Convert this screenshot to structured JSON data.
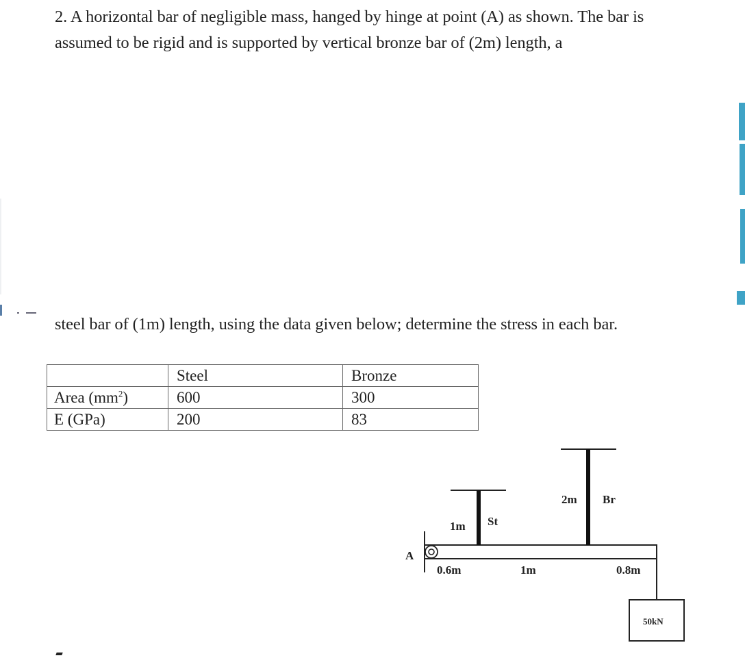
{
  "problem": {
    "paragraph_1": "2. A horizontal bar of negligible mass, hanged by hinge at point (A) as shown. The bar is assumed to be rigid and is supported by vertical bronze bar of (2m) length, a",
    "paragraph_2": "steel bar of (1m) length, using the data given below; determine the stress in each bar."
  },
  "table": {
    "headers": [
      "",
      "Steel",
      "Bronze"
    ],
    "rows": [
      {
        "label": "Area (mm",
        "label_sup": "2",
        "label_suffix": ")",
        "steel": "600",
        "bronze": "300"
      },
      {
        "label": "E (GPa)",
        "label_sup": "",
        "label_suffix": "",
        "steel": "200",
        "bronze": "83"
      }
    ]
  },
  "diagram": {
    "hinge_label": "A",
    "steel_length_label": "1m",
    "steel_name_label": "St",
    "bronze_length_label": "2m",
    "bronze_name_label": "Br",
    "segment_labels": [
      "0.6m",
      "1m",
      "0.8m"
    ],
    "load_label": "50kN",
    "segments_m": [
      0.6,
      1.0,
      0.8
    ],
    "steel_length_m": 1,
    "bronze_length_m": 2,
    "load_kN": 50
  },
  "colors": {
    "text": "#222222",
    "artifact_blue": "#3fa3c6"
  }
}
